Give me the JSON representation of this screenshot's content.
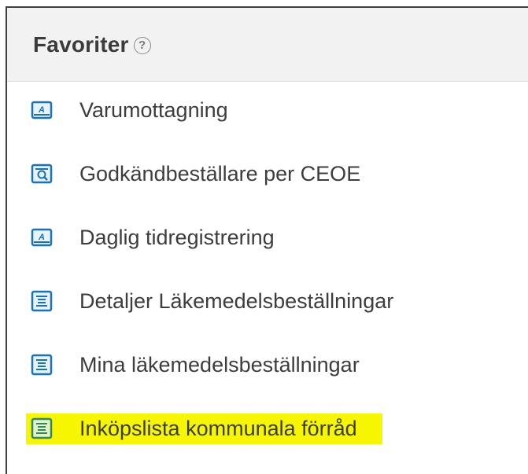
{
  "panel": {
    "title": "Favoriter",
    "help_glyph": "?"
  },
  "items": [
    {
      "label": "Varumottagning",
      "icon": "form-icon"
    },
    {
      "label": "Godkändbeställare per CEOE",
      "icon": "search-report-icon"
    },
    {
      "label": "Daglig tidregistrering",
      "icon": "form-icon"
    },
    {
      "label": "Detaljer Läkemedelsbeställningar",
      "icon": "list-report-icon"
    },
    {
      "label": "Mina läkemedelsbeställningar",
      "icon": "list-report-icon"
    },
    {
      "label": "Inköpslista kommunala förråd",
      "icon": "list-report-icon",
      "highlighted": true
    }
  ],
  "colors": {
    "icon_blue": "#1a73b5",
    "highlight": "#f6f600",
    "text": "#3d3d3d"
  }
}
